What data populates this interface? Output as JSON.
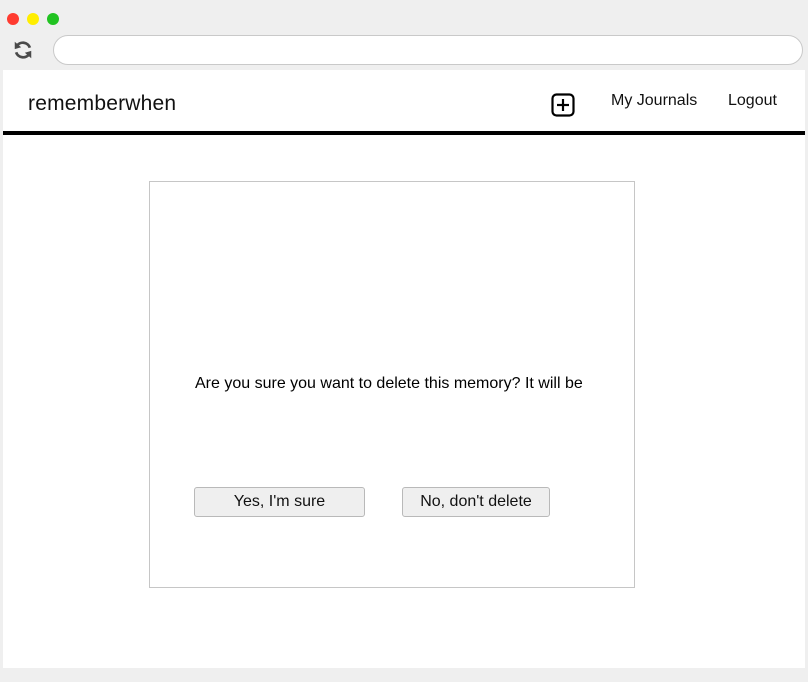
{
  "browser": {
    "address_value": "",
    "traffic_lights": {
      "close": "#ff3b30",
      "minimize": "#ffee00",
      "zoom": "#21c321"
    },
    "reload_icon": "reload-icon"
  },
  "navbar": {
    "brand": "rememberwhen",
    "add_icon": "plus-square-icon",
    "my_journals": "My Journals",
    "logout": "Logout",
    "border_color": "#000000"
  },
  "dialog": {
    "message": "Are you sure you want to delete this memory? It will be",
    "confirm_label": "Yes, I'm sure",
    "cancel_label": "No, don't delete"
  }
}
